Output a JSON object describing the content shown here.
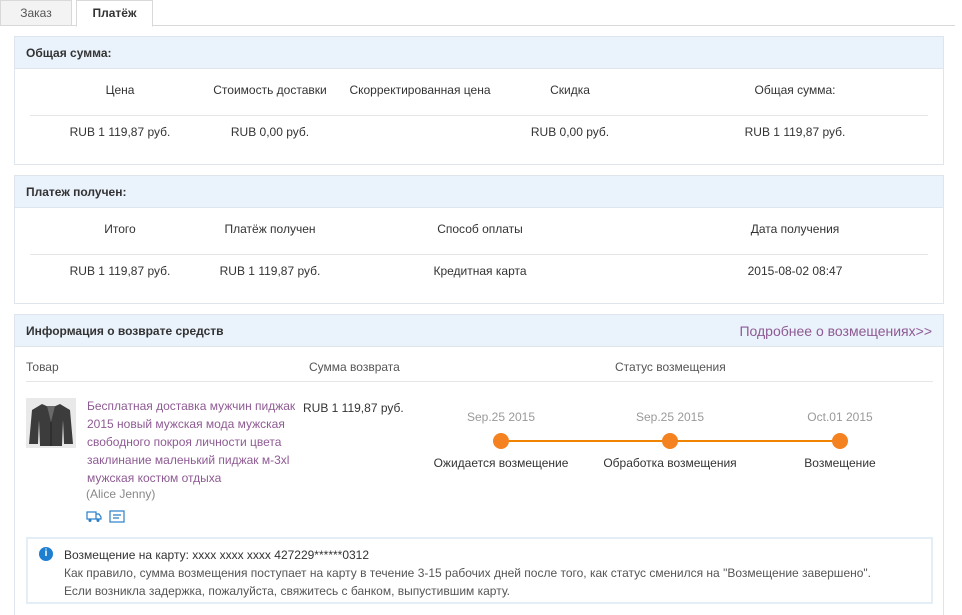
{
  "tabs": {
    "order": "Заказ",
    "payment": "Платёж"
  },
  "total": {
    "title": "Общая сумма:",
    "headers": [
      "Цена",
      "Стоимость доставки",
      "Скорректированная цена",
      "Скидка",
      "Общая сумма:"
    ],
    "values": [
      "RUB 1 119,87 руб.",
      "RUB 0,00 руб.",
      "",
      "RUB 0,00 руб.",
      "RUB 1 119,87 руб."
    ]
  },
  "received": {
    "title": "Платеж получен:",
    "headers": [
      "Итого",
      "Платёж получен",
      "Способ оплаты",
      "Дата получения"
    ],
    "values": [
      "RUB 1 119,87 руб.",
      "RUB 1 119,87 руб.",
      "Кредитная карта",
      "2015-08-02 08:47"
    ]
  },
  "refund": {
    "title": "Информация о возврате средств",
    "more_link": "Подробнее о возмещениях>>",
    "col_product": "Товар",
    "col_amount": "Сумма возврата",
    "col_status": "Статус возмещения",
    "product_title": "Бесплатная доставка мужчин пиджак 2015 новый мужская мода мужская свободного покроя личности цвета заклинание маленький пиджак м-3xl мужская костюм отдыха",
    "seller": "(Alice Jenny)",
    "amount": "RUB 1 119,87 руб.",
    "steps": [
      {
        "date": "Sep.25 2015",
        "label": "Ожидается возмещение"
      },
      {
        "date": "Sep.25 2015",
        "label": "Обработка возмещения"
      },
      {
        "date": "Oct.01 2015",
        "label": "Возмещение"
      }
    ],
    "accent_color": "#f58220",
    "link_color": "#8e5a93"
  },
  "notice": {
    "icon": "info-icon",
    "line1_label": "Возмещение на карту:",
    "line1_value": "xxxx xxxx xxxx 427229******0312",
    "line2": "Как правило, сумма возмещения поступает на карту в течение 3-15 рабочих дней после того, как статус сменился на \"Возмещение завершено\".",
    "line3": "Если возникла задержка, пожалуйста, свяжитесь с банком, выпустившим карту."
  }
}
